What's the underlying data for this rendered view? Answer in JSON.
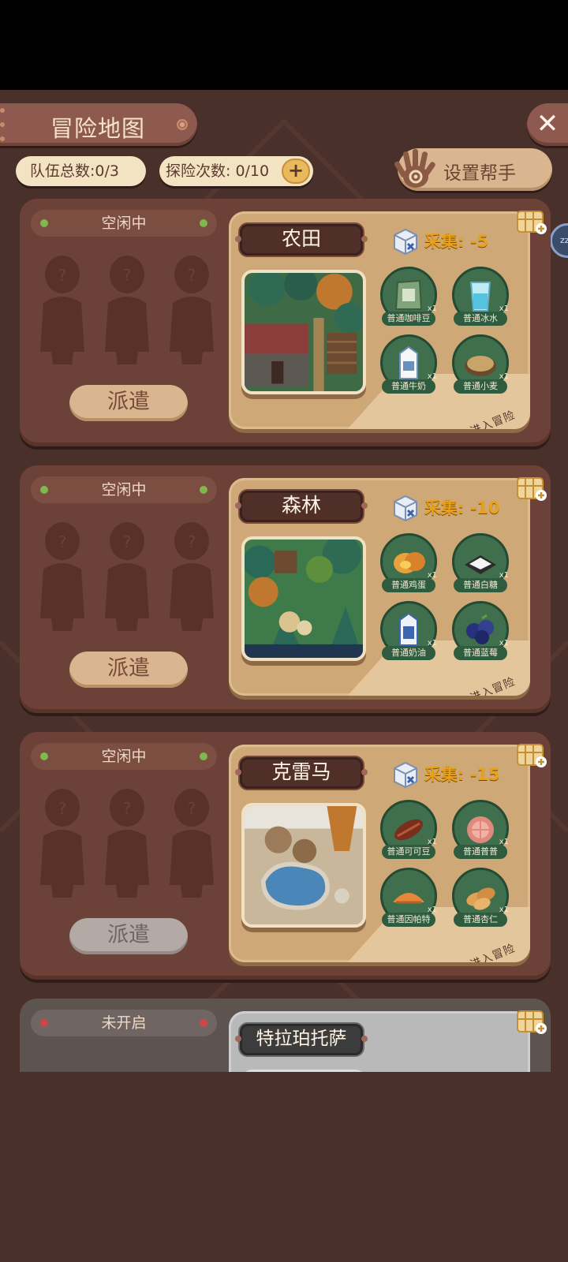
{
  "header": {
    "title": "冒险地图",
    "close_label": "✕",
    "team_total": "队伍总数:0/3",
    "explore_count": "探险次数: 0/10",
    "plus_label": "+",
    "helper_label": "设置帮手",
    "side_bubble": "zz"
  },
  "cards": [
    {
      "status": "空闲中",
      "dispatch": "派遣",
      "location": "农田",
      "collect": "采集: -5",
      "enter": "点击进入冒险",
      "items": [
        {
          "name": "普通咖啡豆",
          "qty": "x1"
        },
        {
          "name": "普通冰水",
          "qty": "x1"
        },
        {
          "name": "普通牛奶",
          "qty": "x1"
        },
        {
          "name": "普通小麦",
          "qty": "x1"
        }
      ]
    },
    {
      "status": "空闲中",
      "dispatch": "派遣",
      "location": "森林",
      "collect": "采集: -10",
      "enter": "点击进入冒险",
      "items": [
        {
          "name": "普通鸡蛋",
          "qty": "x1"
        },
        {
          "name": "普通白糖",
          "qty": "x1"
        },
        {
          "name": "普通奶油",
          "qty": "x1"
        },
        {
          "name": "普通蓝莓",
          "qty": "x1"
        }
      ]
    },
    {
      "status": "空闲中",
      "dispatch": "派遣",
      "location": "克雷马",
      "collect": "采集: -15",
      "enter": "点击进入冒险",
      "items": [
        {
          "name": "普通可可豆",
          "qty": "x1"
        },
        {
          "name": "普通普普",
          "qty": "x1"
        },
        {
          "name": "普通因帕特",
          "qty": "x1"
        },
        {
          "name": "普通杏仁",
          "qty": "x1"
        }
      ]
    },
    {
      "status": "未开启",
      "location": "特拉珀托萨"
    }
  ],
  "colors": {
    "background": "#4a302b",
    "card": "#6c4137",
    "panel": "#cfa877",
    "collect_text": "#e8a21a",
    "idle_led": "#7fb84e",
    "locked_led": "#d04545"
  }
}
